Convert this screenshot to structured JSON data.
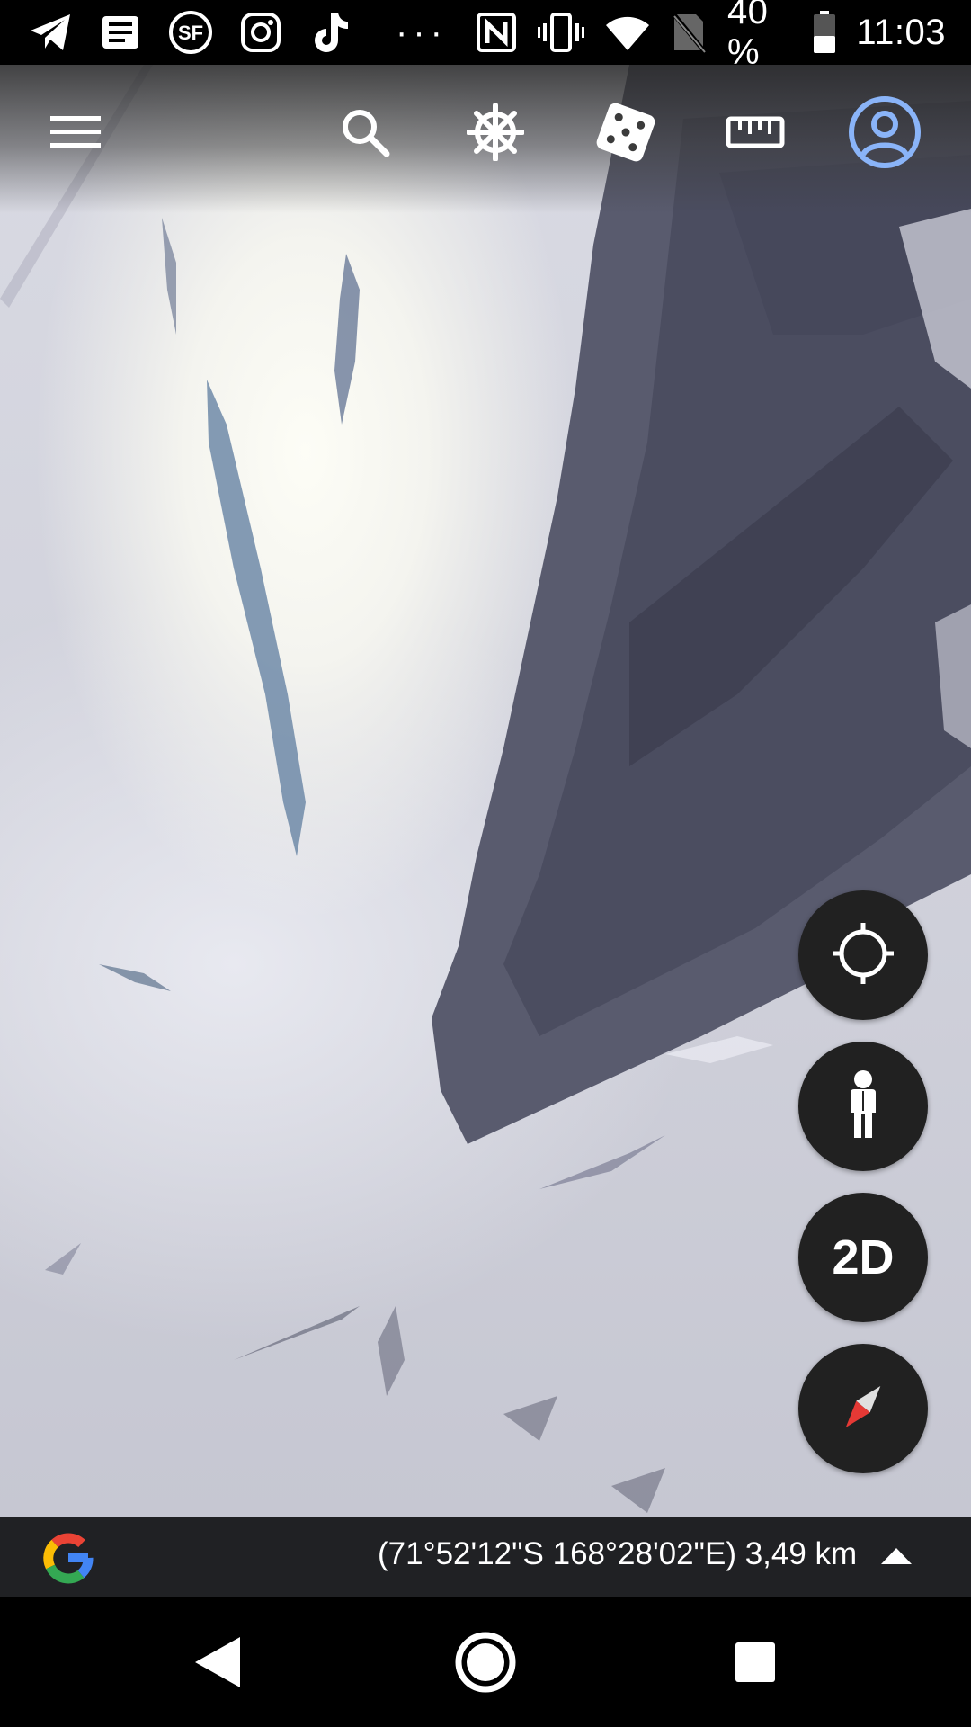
{
  "status_bar": {
    "left_icons": [
      "telegram-icon",
      "news-icon",
      "sf-app-icon",
      "instagram-icon",
      "tiktok-icon"
    ],
    "more_text": "···",
    "right_icons": [
      "nfc-icon",
      "vibrate-icon",
      "wifi-icon",
      "no-sim-icon"
    ],
    "battery_text": "40 %",
    "time": "11:03"
  },
  "toolbar": {
    "icons": [
      "menu-icon",
      "search-icon",
      "voyager-icon",
      "feeling-lucky-dice-icon",
      "measure-ruler-icon",
      "account-icon"
    ],
    "accent_color": "#8ab4f8"
  },
  "map_controls": {
    "my_location": "crosshair-icon",
    "pegman": "pegman-icon",
    "view_mode_label": "2D",
    "compass": "compass-icon"
  },
  "info_bar": {
    "logo": "google-g-logo",
    "coordinates": "(71°52'12\"S 168°28'02\"E) 3,49 km",
    "expand_icon": "chevron-up-icon"
  },
  "nav_bar": {
    "icons": [
      "back-icon",
      "home-icon",
      "recents-icon"
    ]
  }
}
